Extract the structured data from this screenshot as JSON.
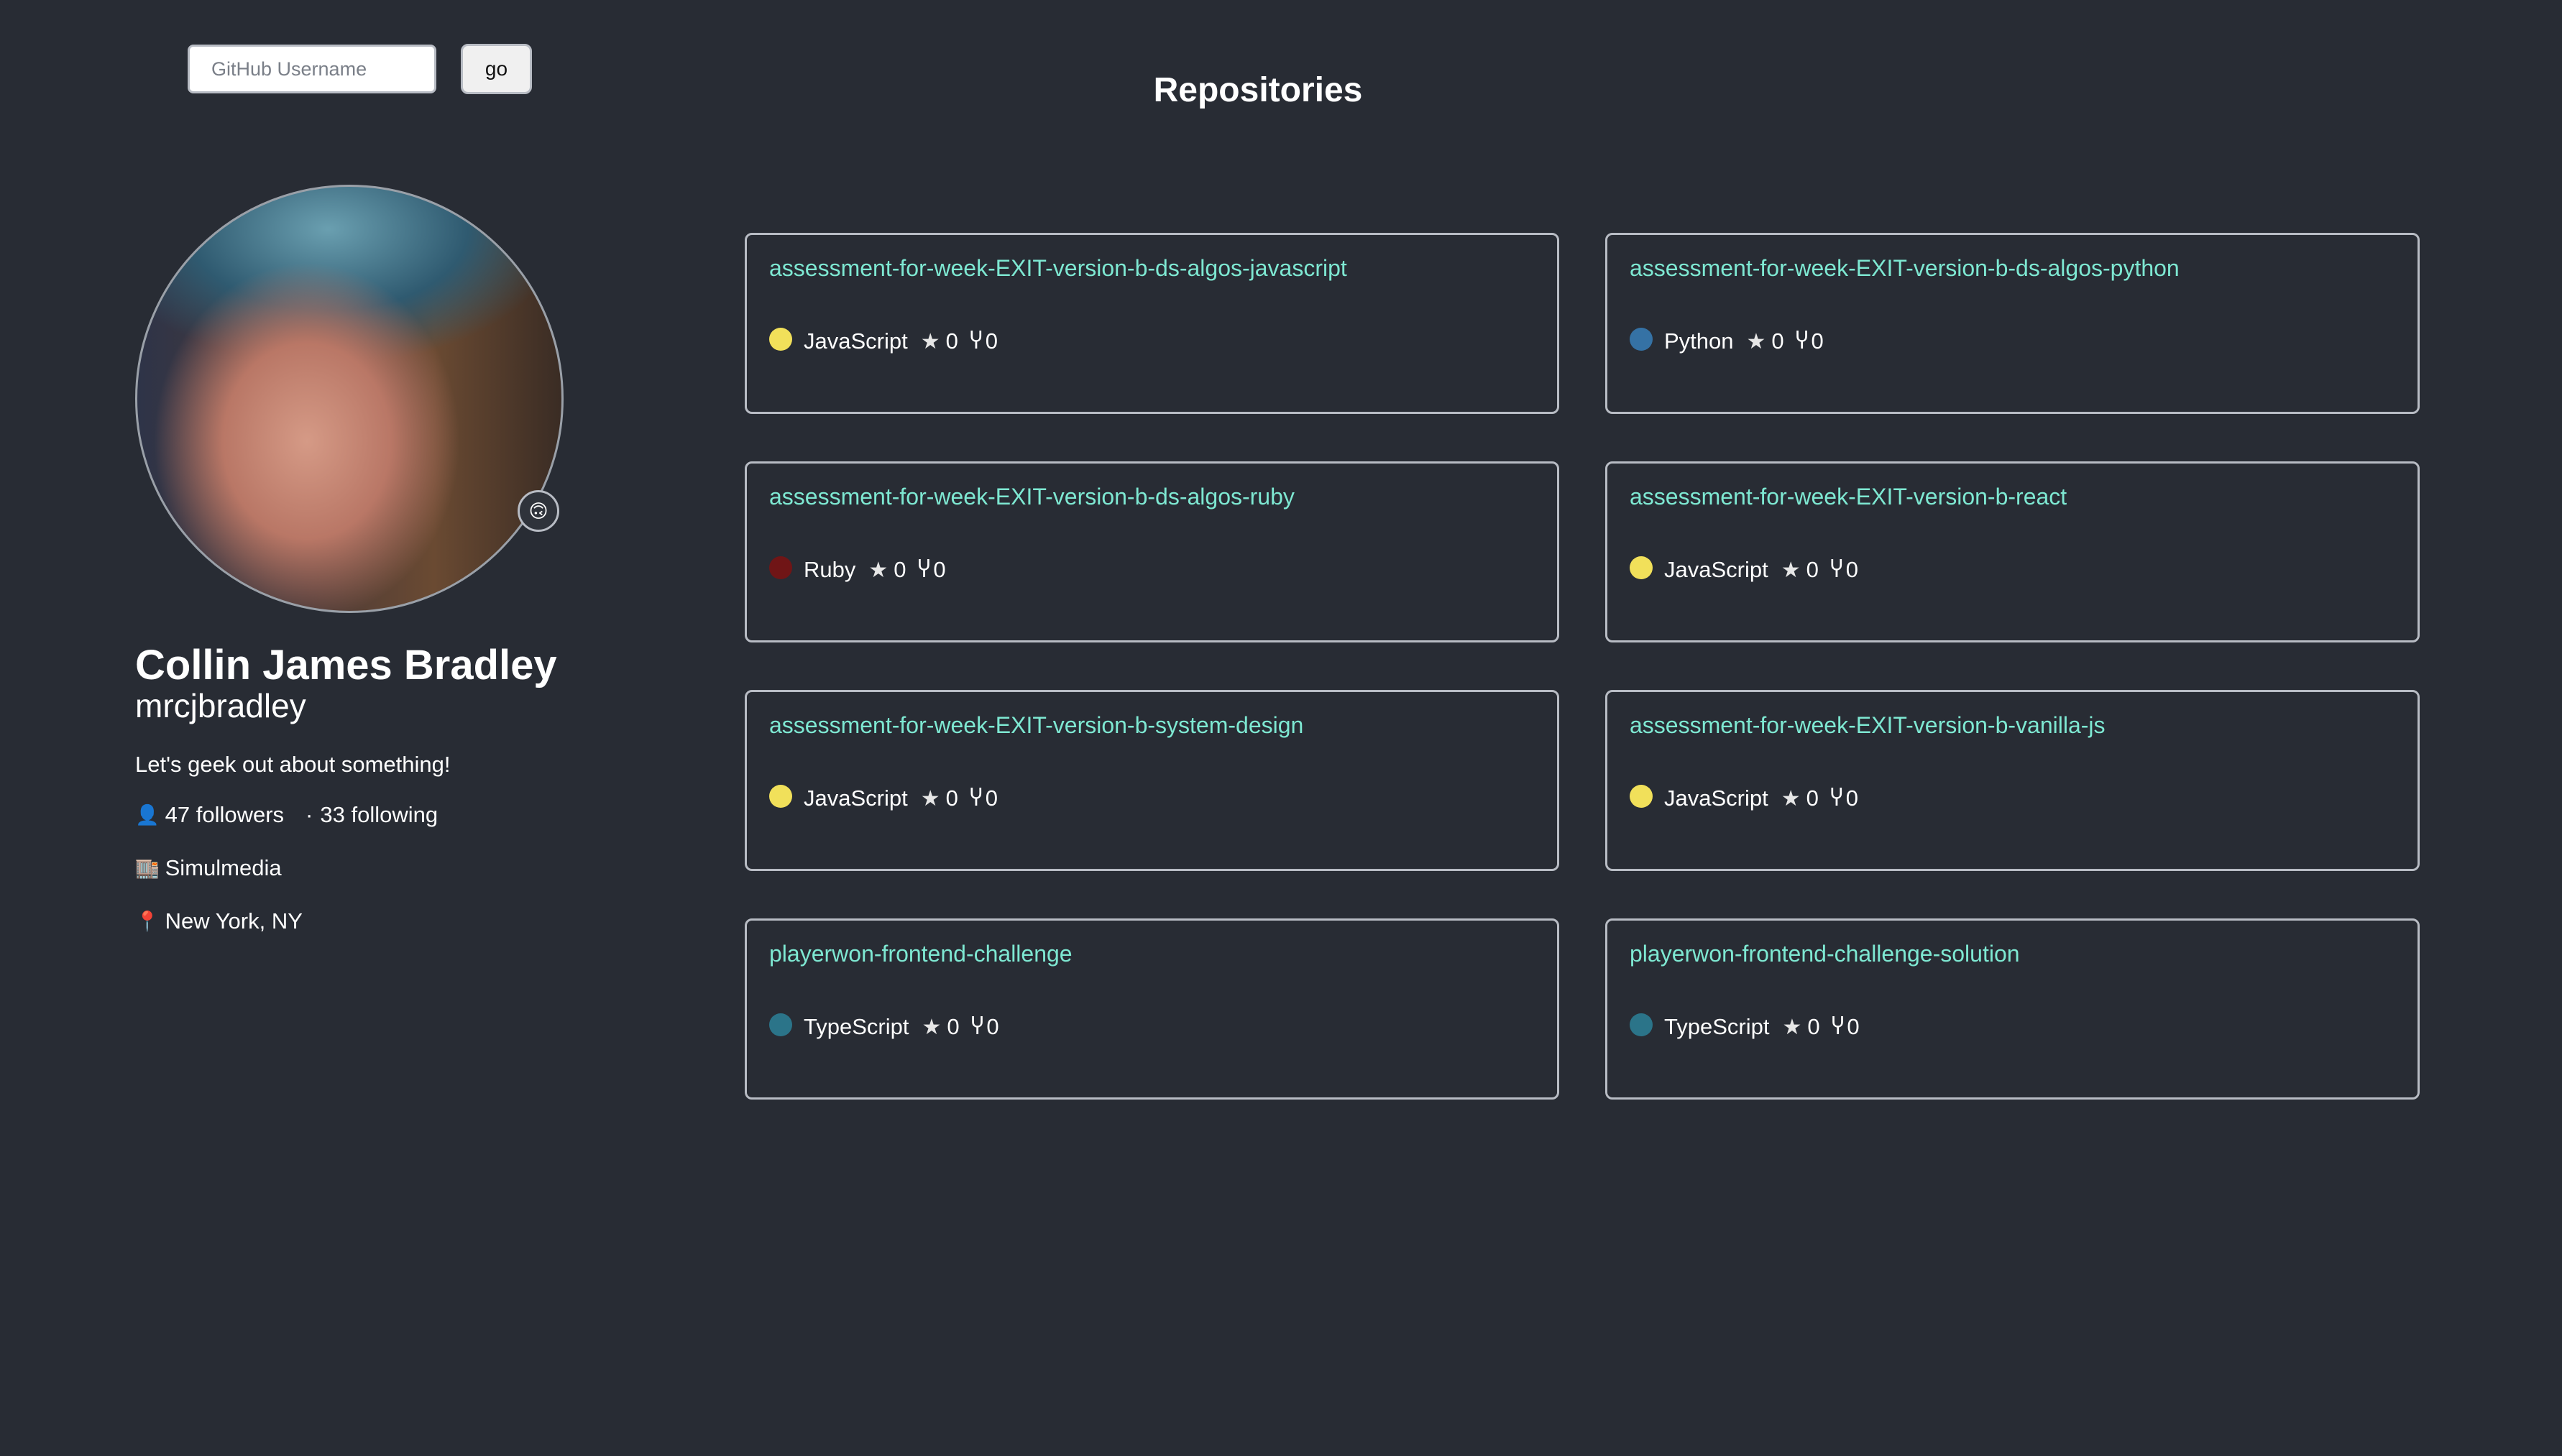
{
  "search": {
    "placeholder": "GitHub Username",
    "value": "",
    "button_label": "go"
  },
  "heading": "Repositories",
  "profile": {
    "full_name": "Collin James Bradley",
    "username": "mrcjbradley",
    "bio": "Let's geek out about something!",
    "status_emoji": "🙃",
    "followers_icon": "👤",
    "followers": "47 followers",
    "separator": "·",
    "following": "33 following",
    "company_icon": "🏬",
    "company": "Simulmedia",
    "location_icon": "📍",
    "location": "New York, NY"
  },
  "icons": {
    "star": "★",
    "fork": "Ⴤ"
  },
  "repos": [
    {
      "name": "assessment-for-week-EXIT-version-b-ds-algos-javascript",
      "language": "JavaScript",
      "lang_color": "#f1e05a",
      "stars": "0",
      "forks": "0"
    },
    {
      "name": "assessment-for-week-EXIT-version-b-ds-algos-python",
      "language": "Python",
      "lang_color": "#3572A5",
      "stars": "0",
      "forks": "0"
    },
    {
      "name": "assessment-for-week-EXIT-version-b-ds-algos-ruby",
      "language": "Ruby",
      "lang_color": "#701516",
      "stars": "0",
      "forks": "0"
    },
    {
      "name": "assessment-for-week-EXIT-version-b-react",
      "language": "JavaScript",
      "lang_color": "#f1e05a",
      "stars": "0",
      "forks": "0"
    },
    {
      "name": "assessment-for-week-EXIT-version-b-system-design",
      "language": "JavaScript",
      "lang_color": "#f1e05a",
      "stars": "0",
      "forks": "0"
    },
    {
      "name": "assessment-for-week-EXIT-version-b-vanilla-js",
      "language": "JavaScript",
      "lang_color": "#f1e05a",
      "stars": "0",
      "forks": "0"
    },
    {
      "name": "playerwon-frontend-challenge",
      "language": "TypeScript",
      "lang_color": "#2b7489",
      "stars": "0",
      "forks": "0"
    },
    {
      "name": "playerwon-frontend-challenge-solution",
      "language": "TypeScript",
      "lang_color": "#2b7489",
      "stars": "0",
      "forks": "0"
    }
  ]
}
